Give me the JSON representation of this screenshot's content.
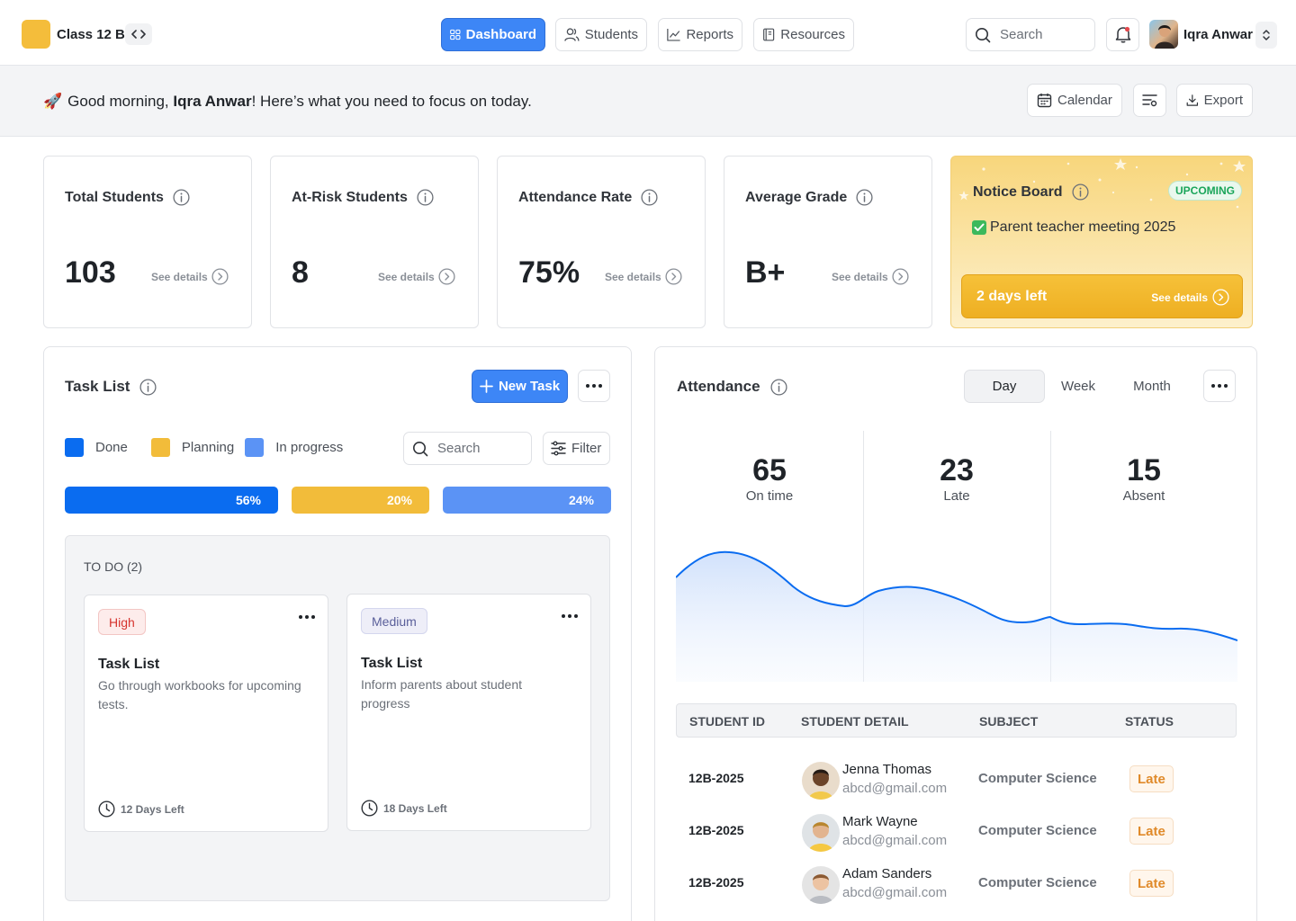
{
  "header": {
    "class_name": "Class 12 B",
    "nav": [
      {
        "label": "Dashboard",
        "icon": "grid-icon",
        "active": true
      },
      {
        "label": "Students",
        "icon": "users-icon"
      },
      {
        "label": "Reports",
        "icon": "chart-line-icon"
      },
      {
        "label": "Resources",
        "icon": "book-icon"
      }
    ],
    "search_placeholder": "Search",
    "user_name": "Iqra Anwar"
  },
  "greeting": {
    "prefix": "Good morning, ",
    "name": "Iqra Anwar",
    "suffix": "! Here’s what you need to focus on today.",
    "emoji": "🚀",
    "calendar_label": "Calendar",
    "export_label": "Export"
  },
  "stats": [
    {
      "title": "Total Students",
      "value": "103",
      "link": "See details"
    },
    {
      "title": "At-Risk Students",
      "value": "8",
      "link": "See details"
    },
    {
      "title": "Attendance Rate",
      "value": "75%",
      "link": "See details"
    },
    {
      "title": "Average Grade",
      "value": "B+",
      "link": "See details"
    }
  ],
  "notice": {
    "title": "Notice Board",
    "badge": "UPCOMING",
    "item": "Parent teacher meeting 2025",
    "days_left": "2 days left",
    "link": "See details"
  },
  "tasks": {
    "title": "Task List",
    "new_task_label": "New Task",
    "legend": [
      {
        "label": "Done",
        "color": "#0a6cf0"
      },
      {
        "label": "Planning",
        "color": "#f2bc3a"
      },
      {
        "label": "In progress",
        "color": "#5b93f5"
      }
    ],
    "search_placeholder": "Search",
    "filter_label": "Filter",
    "progress": [
      {
        "label": "56%",
        "value": 56,
        "color": "#0a6cf0"
      },
      {
        "label": "20%",
        "value": 20,
        "color": "#f2bc3a"
      },
      {
        "label": "24%",
        "value": 24,
        "color": "#5b93f5"
      }
    ],
    "todo_label": "TO DO (2)",
    "cards": [
      {
        "priority": "High",
        "title": "Task List",
        "desc": "Go through workbooks for upcoming tests.",
        "due": "12 Days Left"
      },
      {
        "priority": "Medium",
        "title": "Task List",
        "desc": "Inform parents about student progress",
        "due": "18 Days Left"
      }
    ]
  },
  "attendance": {
    "title": "Attendance",
    "periods": [
      "Day",
      "Week",
      "Month"
    ],
    "active_period": "Day",
    "metrics": [
      {
        "value": "65",
        "label": "On time"
      },
      {
        "value": "23",
        "label": "Late"
      },
      {
        "value": "15",
        "label": "Absent"
      }
    ],
    "table": {
      "headers": [
        "STUDENT ID",
        "STUDENT DETAIL",
        "SUBJECT",
        "STATUS"
      ],
      "rows": [
        {
          "id": "12B-2025",
          "name": "Jenna Thomas",
          "email": "abcd@gmail.com",
          "subject": "Computer Science",
          "status": "Late"
        },
        {
          "id": "12B-2025",
          "name": "Mark Wayne",
          "email": "abcd@gmail.com",
          "subject": "Computer Science",
          "status": "Late"
        },
        {
          "id": "12B-2025",
          "name": "Adam Sanders",
          "email": "abcd@gmail.com",
          "subject": "Computer Science",
          "status": "Late"
        }
      ]
    }
  }
}
